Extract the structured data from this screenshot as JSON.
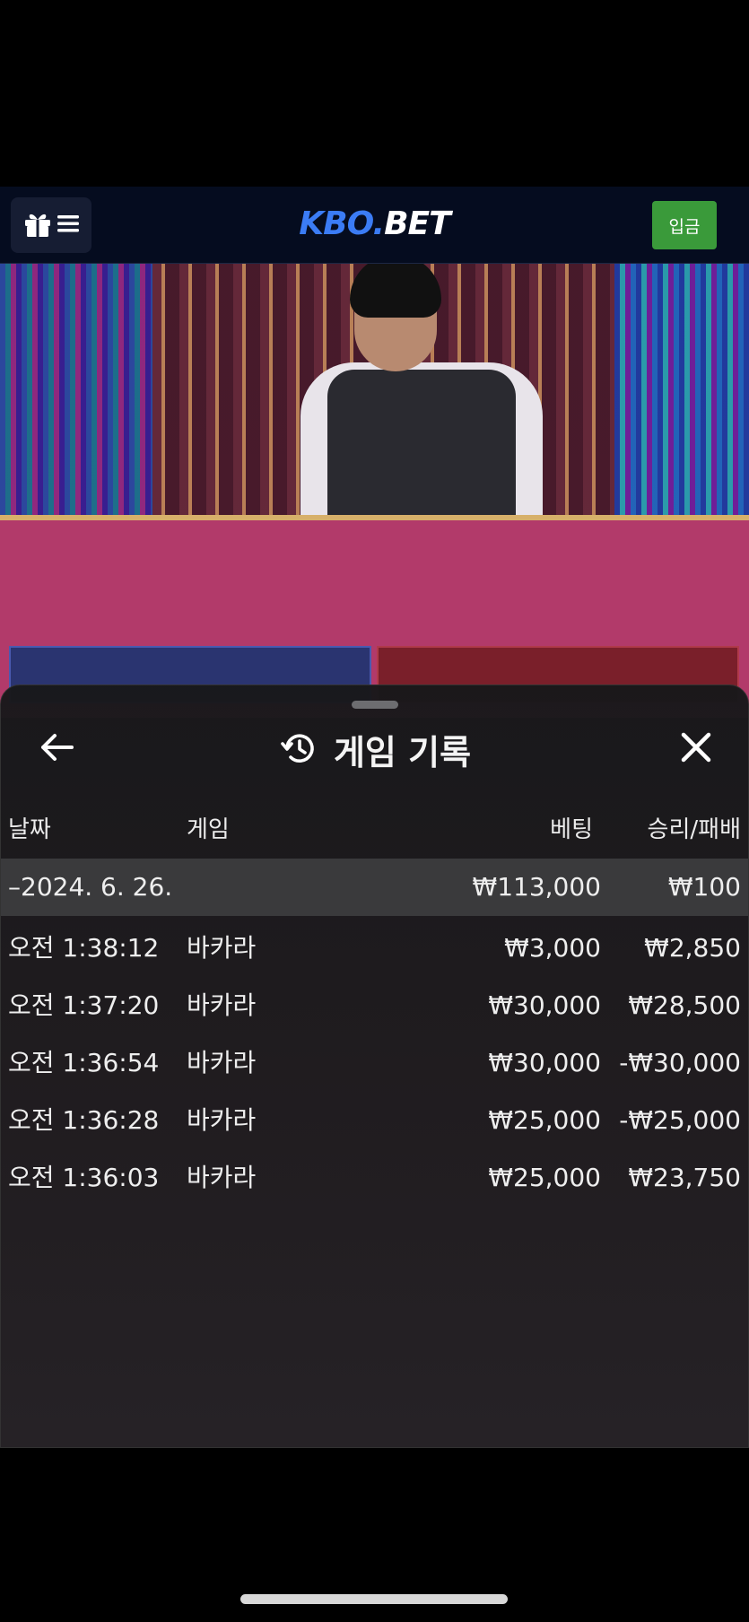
{
  "header": {
    "logo_primary": "KBO.",
    "logo_secondary": "BET",
    "deposit_label": "입금",
    "menu_icons": [
      "gift-icon",
      "hamburger-menu-icon"
    ]
  },
  "history": {
    "title": "게임 기록",
    "columns": {
      "date": "날짜",
      "game": "게임",
      "bet": "베팅",
      "result": "승리/패배"
    },
    "date_group": {
      "date": "–2024. 6. 26.",
      "bet_total": "₩113,000",
      "result_total": "₩100"
    },
    "rows": [
      {
        "time": "오전 1:38:12",
        "game": "바카라",
        "bet": "₩3,000",
        "result": "₩2,850"
      },
      {
        "time": "오전 1:37:20",
        "game": "바카라",
        "bet": "₩30,000",
        "result": "₩28,500"
      },
      {
        "time": "오전 1:36:54",
        "game": "바카라",
        "bet": "₩30,000",
        "result": "-₩30,000"
      },
      {
        "time": "오전 1:36:28",
        "game": "바카라",
        "bet": "₩25,000",
        "result": "-₩25,000"
      },
      {
        "time": "오전 1:36:03",
        "game": "바카라",
        "bet": "₩25,000",
        "result": "₩23,750"
      }
    ]
  },
  "colors": {
    "header_bg": "#050c1f",
    "logo_accent": "#3b7cf5",
    "deposit_green": "#3a9a3a",
    "sheet_bg": "#18181a",
    "date_row_bg": "#3a3a3c"
  }
}
